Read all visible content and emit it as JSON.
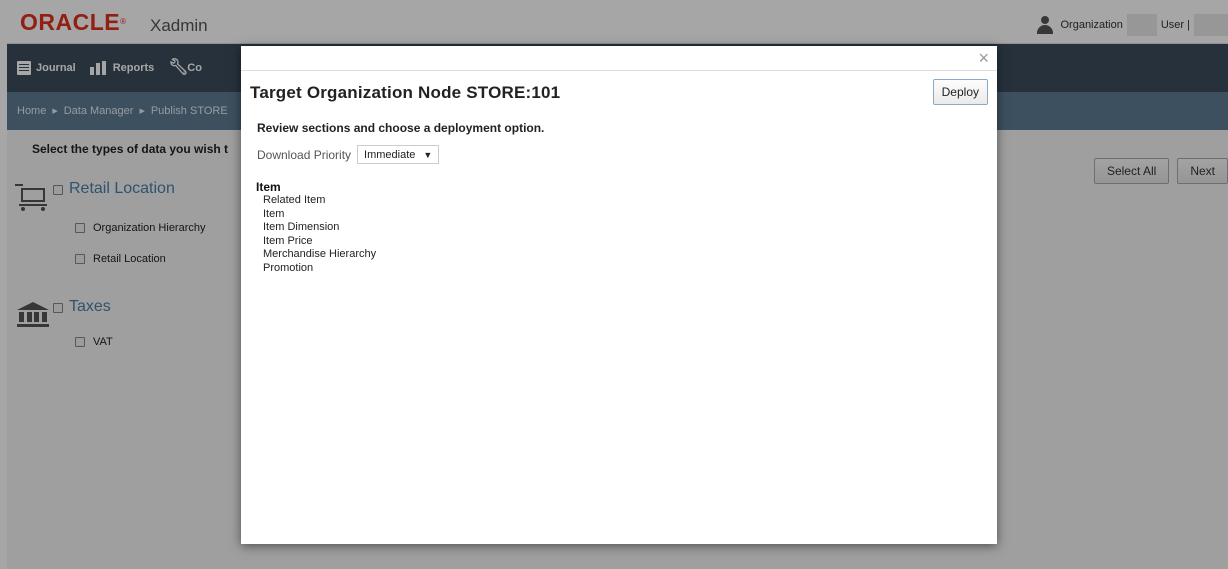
{
  "header": {
    "logo_text": "ORACLE",
    "logo_mark": "®",
    "app_name": "Xadmin",
    "org_label": "Organization",
    "user_label": "User |"
  },
  "nav": {
    "items": [
      {
        "label": "Journal",
        "icon": "journal-icon"
      },
      {
        "label": "Reports",
        "icon": "reports-icon"
      },
      {
        "label": "Co",
        "icon": "wrench-icon"
      }
    ]
  },
  "breadcrumb": [
    "Home",
    "Data Manager",
    "Publish STORE"
  ],
  "content": {
    "instruction": "Select the types of data you wish t",
    "select_all_label": "Select All",
    "next_label": "Next",
    "sections": [
      {
        "title": "Retail Location",
        "icon": "cart-icon",
        "items": [
          "Organization Hierarchy",
          "Retail Location"
        ]
      },
      {
        "title": "Taxes",
        "icon": "bank-icon",
        "items": [
          "VAT"
        ]
      }
    ]
  },
  "modal": {
    "close_glyph": "×",
    "title": "Target Organization Node STORE:101",
    "deploy_label": "Deploy",
    "subtitle": "Review sections and choose a deployment option.",
    "priority_label": "Download Priority",
    "priority_value": "Immediate",
    "list_heading": "Item",
    "list_items": [
      "Related Item",
      "Item",
      "Item Dimension",
      "Item Price",
      "Merchandise Hierarchy",
      "Promotion"
    ]
  }
}
